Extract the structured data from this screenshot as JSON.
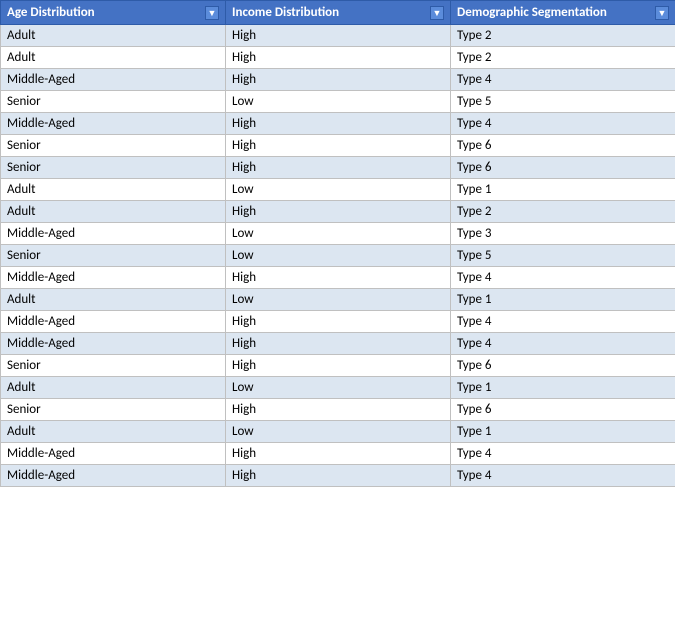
{
  "table": {
    "columns": [
      {
        "id": "age",
        "label": "Age Distribution",
        "key": "age"
      },
      {
        "id": "income",
        "label": "Income Distribution",
        "key": "income"
      },
      {
        "id": "demo",
        "label": "Demographic Segmentation",
        "key": "demo"
      }
    ],
    "rows": [
      {
        "age": "Adult",
        "income": "High",
        "demo": "Type 2"
      },
      {
        "age": "Adult",
        "income": "High",
        "demo": "Type 2"
      },
      {
        "age": "Middle-Aged",
        "income": "High",
        "demo": "Type 4"
      },
      {
        "age": "Senior",
        "income": "Low",
        "demo": "Type 5"
      },
      {
        "age": "Middle-Aged",
        "income": "High",
        "demo": "Type 4"
      },
      {
        "age": "Senior",
        "income": "High",
        "demo": "Type 6"
      },
      {
        "age": "Senior",
        "income": "High",
        "demo": "Type 6"
      },
      {
        "age": "Adult",
        "income": "Low",
        "demo": "Type 1"
      },
      {
        "age": "Adult",
        "income": "High",
        "demo": "Type 2"
      },
      {
        "age": "Middle-Aged",
        "income": "Low",
        "demo": "Type 3"
      },
      {
        "age": "Senior",
        "income": "Low",
        "demo": "Type 5"
      },
      {
        "age": "Middle-Aged",
        "income": "High",
        "demo": "Type 4"
      },
      {
        "age": "Adult",
        "income": "Low",
        "demo": "Type 1"
      },
      {
        "age": "Middle-Aged",
        "income": "High",
        "demo": "Type 4"
      },
      {
        "age": "Middle-Aged",
        "income": "High",
        "demo": "Type 4"
      },
      {
        "age": "Senior",
        "income": "High",
        "demo": "Type 6"
      },
      {
        "age": "Adult",
        "income": "Low",
        "demo": "Type 1"
      },
      {
        "age": "Senior",
        "income": "High",
        "demo": "Type 6"
      },
      {
        "age": "Adult",
        "income": "Low",
        "demo": "Type 1"
      },
      {
        "age": "Middle-Aged",
        "income": "High",
        "demo": "Type 4"
      },
      {
        "age": "Middle-Aged",
        "income": "High",
        "demo": "Type 4"
      }
    ],
    "dropdown_symbol": "▼"
  }
}
